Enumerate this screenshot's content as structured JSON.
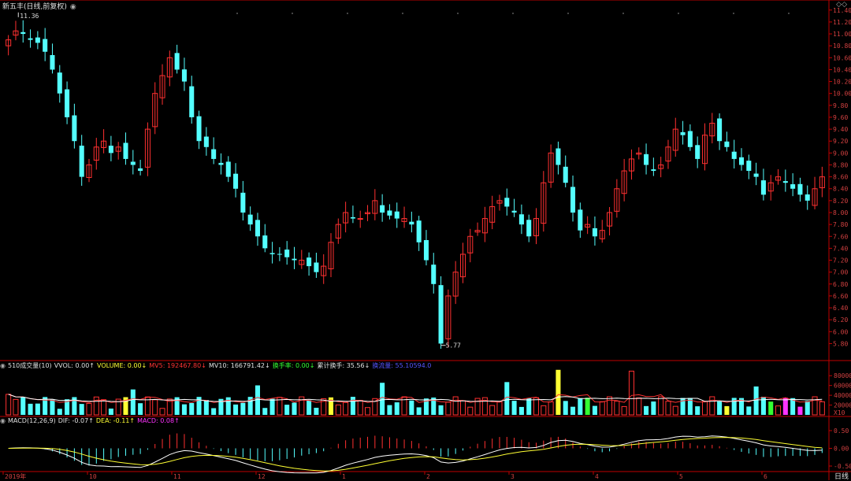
{
  "title": "新五丰(日线,前复权)",
  "corner_icon": "◇◇",
  "colors": {
    "up": "#ff3030",
    "down": "#54ffff",
    "grid": "#5a0000",
    "axis": "#c00000",
    "ma1": "#ffffff",
    "ma2": "#ff3333",
    "yellow": "#ffff33",
    "green": "#33ff33",
    "purple": "#ff33ff",
    "blue": "#5555ff",
    "orange": "#ffaa33"
  },
  "price_axis": {
    "ticks": [
      "11.40",
      "11.20",
      "11.00",
      "10.80",
      "10.60",
      "10.40",
      "10.20",
      "10.00",
      "9.80",
      "9.60",
      "9.40",
      "9.20",
      "9.00",
      "8.80",
      "8.60",
      "8.40",
      "8.20",
      "8.00",
      "7.80",
      "7.60",
      "7.40",
      "7.20",
      "7.00",
      "6.80",
      "6.60",
      "6.40",
      "6.20",
      "6.00",
      "5.80"
    ]
  },
  "price_labels": {
    "high": "11.36",
    "low": "5.77"
  },
  "volume_axis": {
    "ticks": [
      "80000",
      "60000",
      "40000",
      "20000"
    ],
    "unit": "X10"
  },
  "macd_axis": {
    "ticks": [
      "0.50",
      "0.00",
      "-0.50"
    ]
  },
  "x_labels": [
    "2019年",
    "10",
    "11",
    "12",
    "1",
    "2",
    "3",
    "4",
    "5",
    "6"
  ],
  "volume_indicator": {
    "name": "510成交量(10)",
    "vvol": "VVOL: 0.00↑",
    "volume": "VOLUME: 0.00↓",
    "mv5": "MV5: 192467.80↓",
    "mv10": "MV10: 166791.42↓",
    "turnover": "换手率: 0.00↓",
    "cum_turnover": "累计换手: 35.56↓",
    "extra": "换流量: 55.10594.0"
  },
  "macd_indicator": {
    "name": "MACD(12,26,9)",
    "dif": "DIF: -0.07↑",
    "dea": "DEA: -0.11↑",
    "macd": "MACD: 0.08↑"
  },
  "period_label": "日线",
  "chart_data": {
    "type": "candlestick",
    "title": "新五丰(日线,前复权)",
    "y_range": [
      5.7,
      11.45
    ],
    "highest": 11.36,
    "lowest": 5.77,
    "closes": [
      10.9,
      11.05,
      11.0,
      10.9,
      10.85,
      10.7,
      10.4,
      10.0,
      9.6,
      9.2,
      8.6,
      8.8,
      9.1,
      9.2,
      9.0,
      9.1,
      8.9,
      8.8,
      8.7,
      9.4,
      10.0,
      10.3,
      10.6,
      10.4,
      10.2,
      9.6,
      9.2,
      9.1,
      8.9,
      8.8,
      8.6,
      8.4,
      8.0,
      7.8,
      7.6,
      7.4,
      7.3,
      7.3,
      7.25,
      7.2,
      7.2,
      7.1,
      7.0,
      7.1,
      7.5,
      7.8,
      8.0,
      7.9,
      7.9,
      8.0,
      8.2,
      8.0,
      7.95,
      7.9,
      7.9,
      7.8,
      7.5,
      7.2,
      6.8,
      5.8,
      6.6,
      7.0,
      7.3,
      7.6,
      7.7,
      7.9,
      8.1,
      8.2,
      8.1,
      8.0,
      7.8,
      7.6,
      7.9,
      8.5,
      9.0,
      8.8,
      8.5,
      8.0,
      7.7,
      7.8,
      7.6,
      7.7,
      8.0,
      8.4,
      8.7,
      8.9,
      9.0,
      8.8,
      8.7,
      8.8,
      9.1,
      9.4,
      9.3,
      9.1,
      8.9,
      9.3,
      9.5,
      9.2,
      9.1,
      8.9,
      8.8,
      8.7,
      8.6,
      8.3,
      8.5,
      8.6,
      8.5,
      8.4,
      8.3,
      8.2,
      8.4,
      8.6
    ]
  }
}
